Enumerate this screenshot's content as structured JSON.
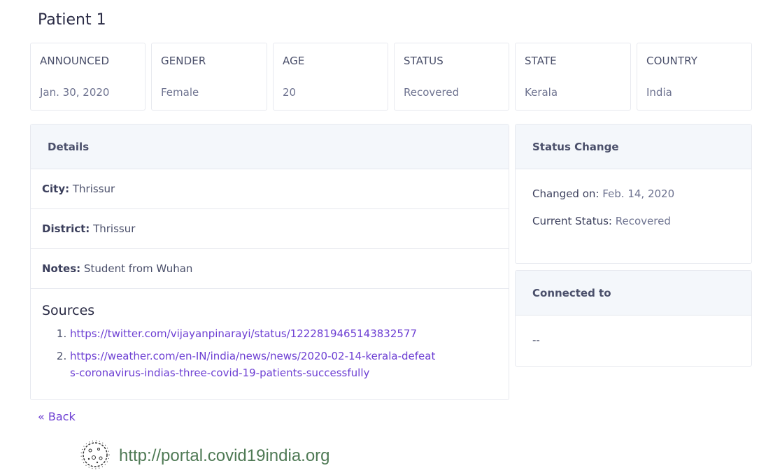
{
  "page": {
    "title": "Patient 1"
  },
  "stats": [
    {
      "label": "ANNOUNCED",
      "value": "Jan. 30, 2020"
    },
    {
      "label": "GENDER",
      "value": "Female"
    },
    {
      "label": "AGE",
      "value": "20"
    },
    {
      "label": "STATUS",
      "value": "Recovered"
    },
    {
      "label": "STATE",
      "value": "Kerala"
    },
    {
      "label": "COUNTRY",
      "value": "India"
    }
  ],
  "details": {
    "header": "Details",
    "city_label": "City:",
    "city": "Thrissur",
    "district_label": "District:",
    "district": "Thrissur",
    "notes_label": "Notes:",
    "notes": "Student from Wuhan",
    "sources_title": "Sources",
    "sources": [
      "https://twitter.com/vijayanpinarayi/status/1222819465143832577",
      "https://weather.com/en-IN/india/news/news/2020-02-14-kerala-defeats-coronavirus-indias-three-covid-19-patients-successfully"
    ]
  },
  "status_change": {
    "header": "Status Change",
    "changed_on_label": "Changed on:",
    "changed_on": "Feb. 14, 2020",
    "current_status_label": "Current Status:",
    "current_status": "Recovered"
  },
  "connected": {
    "header": "Connected to",
    "value": "--"
  },
  "nav": {
    "back_label": "« Back"
  },
  "watermark": {
    "text": "http://portal.covid19india.org",
    "icon": "virus-icon"
  },
  "colors": {
    "accent": "#6d3fd3",
    "header_bg": "#f4f7fb",
    "border": "#e7e9ef",
    "watermark": "#4f7a55"
  }
}
